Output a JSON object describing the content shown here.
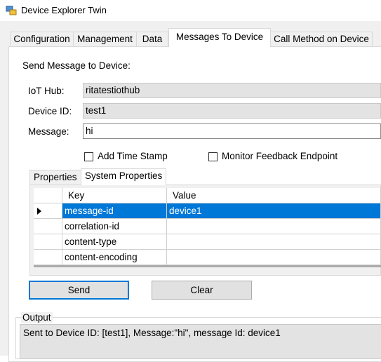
{
  "window": {
    "title": "Device Explorer Twin",
    "icon": "app-icon"
  },
  "tabs": [
    {
      "label": "Configuration"
    },
    {
      "label": "Management"
    },
    {
      "label": "Data"
    },
    {
      "label": "Messages To Device",
      "active": true
    },
    {
      "label": "Call Method on Device"
    }
  ],
  "section_title": "Send Message to Device:",
  "form": {
    "iot_hub_label": "IoT Hub:",
    "iot_hub_value": "ritatestiothub",
    "device_id_label": "Device ID:",
    "device_id_value": "test1",
    "message_label": "Message:",
    "message_value": "hi"
  },
  "options": {
    "add_time_stamp": {
      "label": "Add Time Stamp",
      "checked": false
    },
    "monitor_feedback": {
      "label": "Monitor Feedback Endpoint",
      "checked": false
    }
  },
  "inner_tabs": [
    {
      "label": "Properties"
    },
    {
      "label": "System Properties",
      "active": true
    }
  ],
  "grid": {
    "headers": {
      "key": "Key",
      "value": "Value"
    },
    "rows": [
      {
        "key": "message-id",
        "value": "device1",
        "selected": true
      },
      {
        "key": "correlation-id",
        "value": ""
      },
      {
        "key": "content-type",
        "value": ""
      },
      {
        "key": "content-encoding",
        "value": ""
      }
    ]
  },
  "buttons": {
    "send": "Send",
    "clear": "Clear"
  },
  "output": {
    "label": "Output",
    "text": "Sent to Device ID: [test1], Message:\"hi\", message Id: device1"
  },
  "colors": {
    "selection": "#0078d7",
    "default_button_border": "#0078d7"
  }
}
